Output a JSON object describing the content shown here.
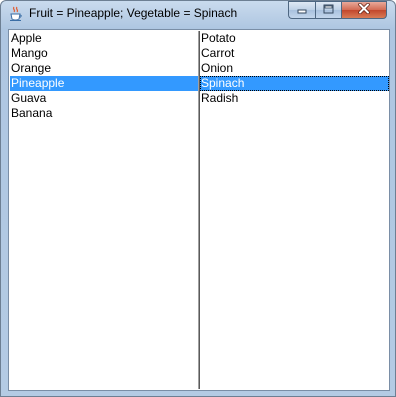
{
  "window": {
    "title": "Fruit = Pineapple; Vegetable = Spinach"
  },
  "caption_buttons": {
    "minimize_icon": "minimize-icon",
    "maximize_icon": "maximize-icon",
    "close_icon": "close-icon"
  },
  "fruit_list": {
    "items": [
      "Apple",
      "Mango",
      "Orange",
      "Pineapple",
      "Guava",
      "Banana"
    ],
    "selected": "Pineapple"
  },
  "vegetable_list": {
    "items": [
      "Potato",
      "Carrot",
      "Onion",
      "Spinach",
      "Radish"
    ],
    "selected": "Spinach"
  },
  "colors": {
    "selection": "#3399ff",
    "selection_text": "#ffffff",
    "close_button": "#c7472c"
  }
}
